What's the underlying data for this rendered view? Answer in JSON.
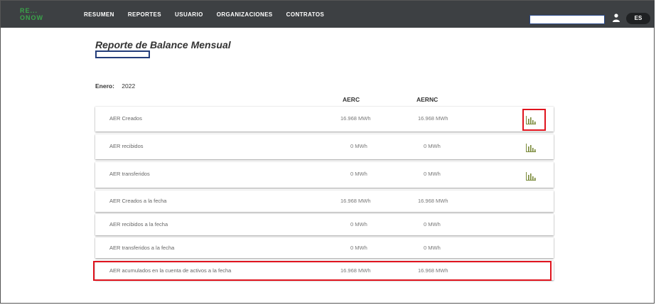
{
  "nav": {
    "logo_top": "RE...",
    "logo_bottom": "ONOW",
    "items": [
      "RESUMEN",
      "REPORTES",
      "USUARIO",
      "ORGANIZACIONES",
      "CONTRATOS"
    ],
    "search_value": "",
    "lang": "ES"
  },
  "page": {
    "title": "Reporte de Balance Mensual",
    "period_label": "Enero:",
    "period_value": "2022"
  },
  "columns": [
    "AERC",
    "AERNC"
  ],
  "rows": [
    {
      "label": "AER Creados",
      "aerc": "16.968 MWh",
      "aernc": "16.968 MWh",
      "chart_icon": "bar-chart-icon"
    },
    {
      "label": "AER recibidos",
      "aerc": "0 MWh",
      "aernc": "0 MWh",
      "chart_icon": "bar-chart-icon"
    },
    {
      "label": "AER transferidos",
      "aerc": "0 MWh",
      "aernc": "0 MWh",
      "chart_icon": "bar-chart-icon"
    },
    {
      "label": "AER Creados a la fecha",
      "aerc": "16.968 MWh",
      "aernc": "16.968 MWh"
    },
    {
      "label": "AER recibidos a la fecha",
      "aerc": "0 MWh",
      "aernc": "0 MWh"
    },
    {
      "label": "AER transferidos a la fecha",
      "aerc": "0 MWh",
      "aernc": "0 MWh"
    },
    {
      "label": "AER acumulados en la cuenta de activos a la fecha",
      "aerc": "16.968 MWh",
      "aernc": "16.968 MWh"
    }
  ],
  "colors": {
    "navbar": "#3d4043",
    "highlight": "#e0141e",
    "accent_green": "#3aa34a",
    "chart_icon": "#7a8a3a"
  }
}
